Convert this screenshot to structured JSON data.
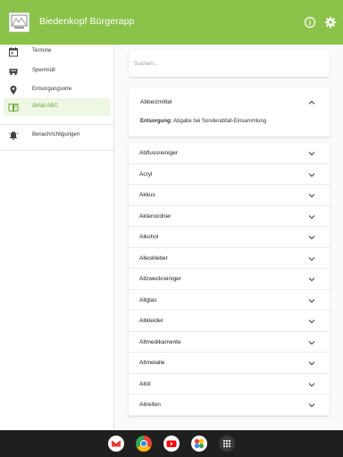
{
  "app": {
    "title": "Biedenkopf Bürgerapp",
    "logo_icon": "city-logo-icon",
    "actions": [
      {
        "icon": "info-icon",
        "label": "Info"
      },
      {
        "icon": "gear-icon",
        "label": "Einstellungen"
      }
    ],
    "colors": {
      "primary": "#8bc34a",
      "active_bg": "#eef6e4",
      "active_text": "#6aa636"
    }
  },
  "sidebar": {
    "items": [
      {
        "icon": "calendar-icon",
        "label": "Termine"
      },
      {
        "icon": "truck-icon",
        "label": "Sperrmüll"
      },
      {
        "icon": "location-pin-icon",
        "label": "Entsorgungsorte"
      },
      {
        "icon": "book-icon",
        "label": "Abfall ABC",
        "active": true
      },
      {
        "icon": "bell-icon",
        "label": "Benachrichtigungen"
      }
    ]
  },
  "search": {
    "placeholder": "Suchen..."
  },
  "expanded_item": {
    "title": "Abbeizmittel",
    "detail_label": "Entsorgung:",
    "detail_value": "Abgabe bei Sonderabfall-Einsammlung"
  },
  "items": [
    "Abflussreiniger",
    "Acryl",
    "Akkus",
    "Aktenordner",
    "Alkohol",
    "Alleskleber",
    "Allzweckreiniger",
    "Altglas",
    "Altkleider",
    "Altmedikamente",
    "Altmetalle",
    "Altöl",
    "Altreifen"
  ],
  "dock": [
    {
      "icon": "gmail-icon",
      "color": "#ea4335"
    },
    {
      "icon": "chrome-icon",
      "color": "#fbbc04"
    },
    {
      "icon": "youtube-icon",
      "color": "#ff0000"
    },
    {
      "icon": "photos-icon",
      "color": "#34a853"
    },
    {
      "icon": "app-launcher-icon",
      "color": "#ffffff"
    }
  ]
}
